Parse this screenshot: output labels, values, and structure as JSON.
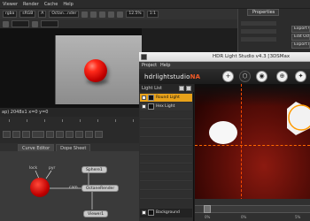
{
  "app": {
    "menu": [
      "Viewer",
      "Render",
      "Cache",
      "Help"
    ],
    "viewer_toolbar": {
      "channels": "rgba",
      "colorspace": "sRGB",
      "input": "A",
      "node_field": "Octan...nder",
      "zoom": "12.5%",
      "ratio": "1:1"
    },
    "status_text": "ap) 2048x1  x=0 y=0",
    "node_tabs": [
      "Curve Editor",
      "Dope Sheet"
    ],
    "nodes": {
      "sphere": "Sphere1",
      "octane_render": "OctaneRender",
      "viewer": "Viewer1",
      "lbl_lock": "lock",
      "lbl_cam": "cam",
      "lbl_pyr": "pyr"
    },
    "properties": {
      "title": "Properties",
      "buttons": [
        "Export Ob",
        "Edit Octan",
        "Export Lig"
      ]
    }
  },
  "hdr_window": {
    "title": "HDR Light Studio v4.3 [3DSMax",
    "menu": [
      "Project",
      "Help"
    ],
    "logo_main": "hdrlightstudio",
    "logo_accent": "NA",
    "tools": [
      {
        "icon": "plus-icon",
        "glyph": "+"
      },
      {
        "icon": "hexagon-icon",
        "glyph": "⬡"
      },
      {
        "icon": "globe-icon",
        "glyph": "◉"
      },
      {
        "icon": "crosshair-icon",
        "glyph": "⊕"
      },
      {
        "icon": "star-icon",
        "glyph": "✦"
      }
    ],
    "light_list": {
      "title": "Light List",
      "items": [
        {
          "name": "Round Light",
          "selected": true
        },
        {
          "name": "Hex Light",
          "selected": false
        }
      ],
      "background_label": "Background"
    },
    "accent_color": "#e8a21a",
    "guide_color": "#ff6a00",
    "bottom_labels": [
      "0%",
      "0%",
      "5%"
    ]
  }
}
